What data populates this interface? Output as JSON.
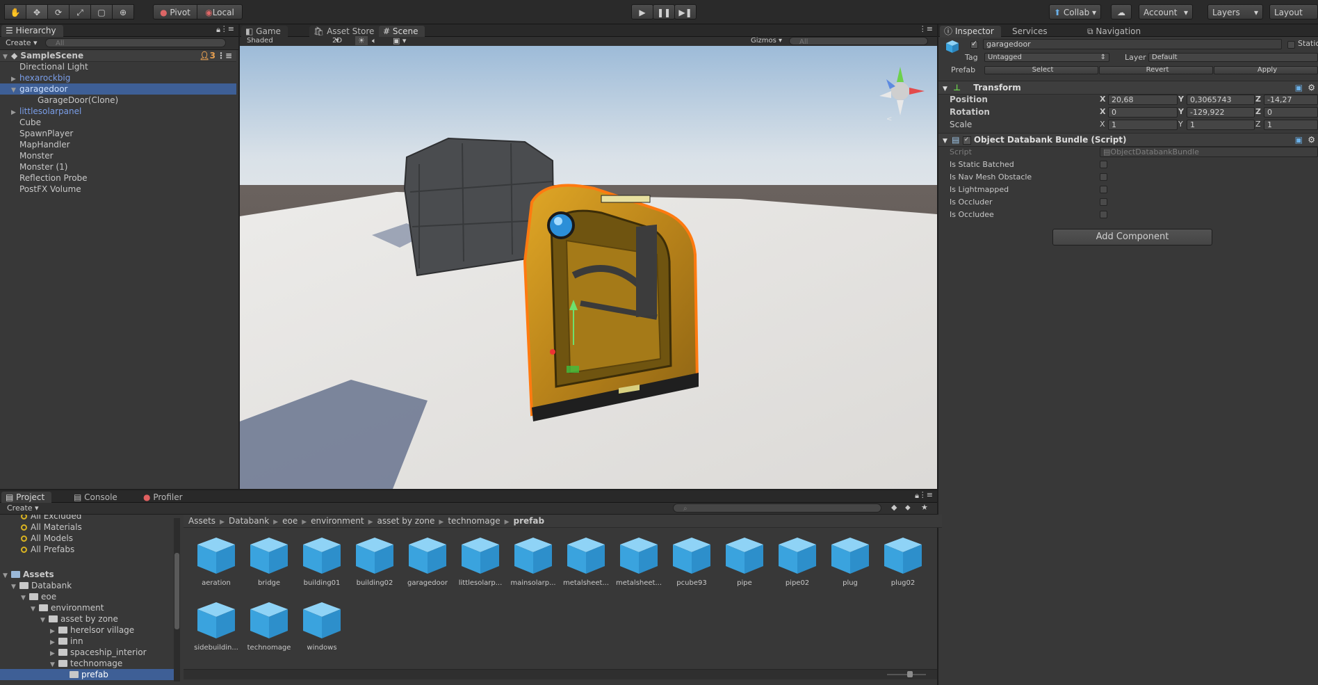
{
  "toolbar": {
    "tools": [
      "hand",
      "move",
      "rotate",
      "scale",
      "rect",
      "transform"
    ],
    "pivot": "Pivot",
    "local": "Local",
    "collab": "Collab",
    "account": "Account",
    "layers": "Layers",
    "layout": "Layout"
  },
  "hierarchy": {
    "tab": "Hierarchy",
    "create": "Create",
    "search_placeholder": "All",
    "scene": "SampleScene",
    "badge": "3",
    "items": [
      {
        "label": "Directional Light",
        "indent": 0,
        "type": "object"
      },
      {
        "label": "hexarockbig",
        "indent": 0,
        "type": "prefab",
        "collapsed": true
      },
      {
        "label": "garagedoor",
        "indent": 0,
        "type": "prefab",
        "expanded": true,
        "selected": true
      },
      {
        "label": "GarageDoor(Clone)",
        "indent": 1,
        "type": "object"
      },
      {
        "label": "littlesolarpanel",
        "indent": 0,
        "type": "prefab",
        "collapsed": true
      },
      {
        "label": "Cube",
        "indent": 0,
        "type": "object"
      },
      {
        "label": "SpawnPlayer",
        "indent": 0,
        "type": "object"
      },
      {
        "label": "MapHandler",
        "indent": 0,
        "type": "object"
      },
      {
        "label": "Monster",
        "indent": 0,
        "type": "object"
      },
      {
        "label": "Monster (1)",
        "indent": 0,
        "type": "object"
      },
      {
        "label": "Reflection Probe",
        "indent": 0,
        "type": "object"
      },
      {
        "label": "PostFX Volume",
        "indent": 0,
        "type": "object"
      }
    ]
  },
  "scene_tabs": {
    "game": "Game",
    "asset_store": "Asset Store",
    "scene": "Scene"
  },
  "scene_bar": {
    "shading": "Shaded",
    "mode_2d": "2D",
    "gizmos": "Gizmos",
    "search_placeholder": "All"
  },
  "inspector": {
    "tabs": {
      "inspector": "Inspector",
      "services": "Services",
      "navigation": "Navigation"
    },
    "object_name": "garagedoor",
    "static_label": "Static",
    "tag_label": "Tag",
    "tag_value": "Untagged",
    "layer_label": "Layer",
    "layer_value": "Default",
    "prefab_label": "Prefab",
    "prefab_select": "Select",
    "prefab_revert": "Revert",
    "prefab_apply": "Apply",
    "transform": {
      "title": "Transform",
      "position_label": "Position",
      "rotation_label": "Rotation",
      "scale_label": "Scale",
      "position": {
        "x": "20,68",
        "y": "0,3065743",
        "z": "-14,27"
      },
      "rotation": {
        "x": "0",
        "y": "-129,922",
        "z": "0"
      },
      "scale": {
        "x": "1",
        "y": "1",
        "z": "1"
      }
    },
    "script_component": {
      "title": "Object Databank Bundle (Script)",
      "script_label": "Script",
      "script_value": "ObjectDatabankBundle",
      "fields": [
        "Is Static Batched",
        "Is Nav Mesh Obstacle",
        "Is Lightmapped",
        "Is Occluder",
        "Is Occludee"
      ]
    },
    "add_component": "Add Component"
  },
  "project": {
    "tabs": {
      "project": "Project",
      "console": "Console",
      "profiler": "Profiler"
    },
    "create": "Create",
    "favorites": [
      "All Excluded",
      "All Materials",
      "All Models",
      "All Prefabs"
    ],
    "tree": {
      "assets": "Assets",
      "databank": "Databank",
      "eoe": "eoe",
      "environment": "environment",
      "asset_by_zone": "asset by zone",
      "herelsor_village": "herelsor village",
      "inn": "inn",
      "spaceship_interior": "spaceship_interior",
      "technomage": "technomage",
      "prefab": "prefab"
    },
    "breadcrumb": [
      "Assets",
      "Databank",
      "eoe",
      "environment",
      "asset by zone",
      "technomage",
      "prefab"
    ],
    "assets": [
      "aeration",
      "bridge",
      "building01",
      "building02",
      "garagedoor",
      "littlesolarp...",
      "mainsolarp...",
      "metalsheet...",
      "metalsheet...",
      "pcube93",
      "pipe",
      "pipe02",
      "plug",
      "plug02",
      "sidebuildin...",
      "technomage",
      "windows"
    ]
  },
  "colors": {
    "selection": "#3e5f96",
    "prefab_text": "#7a9ee8",
    "cube_top": "#8fd3f6",
    "cube_side": "#3aa3de",
    "door_yellow": "#d49a1c",
    "outline_orange": "#ff7a10"
  }
}
